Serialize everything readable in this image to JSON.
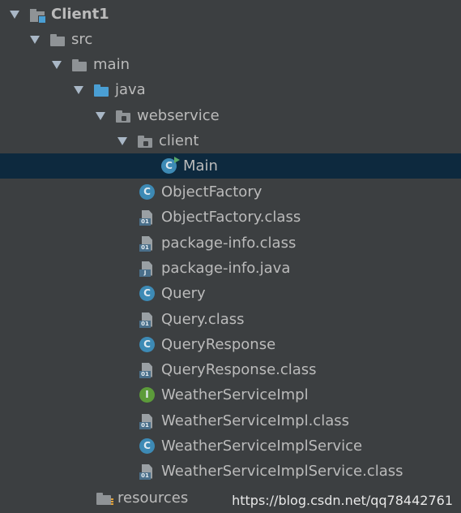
{
  "project_tree": {
    "module": "Client1",
    "src": "src",
    "main": "main",
    "java": "java",
    "webservice": "webservice",
    "client": "client",
    "client_children": [
      {
        "label": "Main",
        "icon": "run-class-icon"
      }
    ],
    "webservice_children": [
      {
        "label": "ObjectFactory",
        "icon": "class-icon",
        "glyph": "C"
      },
      {
        "label": "ObjectFactory.class",
        "icon": "class-file-icon",
        "tag": "01"
      },
      {
        "label": "package-info.class",
        "icon": "class-file-icon",
        "tag": "01"
      },
      {
        "label": "package-info.java",
        "icon": "java-file-icon",
        "tag": "J"
      },
      {
        "label": "Query",
        "icon": "class-icon",
        "glyph": "C"
      },
      {
        "label": "Query.class",
        "icon": "class-file-icon",
        "tag": "01"
      },
      {
        "label": "QueryResponse",
        "icon": "class-icon",
        "glyph": "C"
      },
      {
        "label": "QueryResponse.class",
        "icon": "class-file-icon",
        "tag": "01"
      },
      {
        "label": "WeatherServiceImpl",
        "icon": "interface-icon",
        "glyph": "I"
      },
      {
        "label": "WeatherServiceImpl.class",
        "icon": "class-file-icon",
        "tag": "01"
      },
      {
        "label": "WeatherServiceImplService",
        "icon": "class-icon",
        "glyph": "C"
      },
      {
        "label": "WeatherServiceImplService.class",
        "icon": "class-file-icon",
        "tag": "01"
      }
    ],
    "resources": "resources"
  },
  "watermark": "https://blog.csdn.net/qq78442761",
  "colors": {
    "background": "#3c3f41",
    "selection": "#0d293e",
    "class_icon": "#3d8ab5",
    "interface_icon": "#5c9b3a",
    "source_folder": "#4a9fd4"
  }
}
